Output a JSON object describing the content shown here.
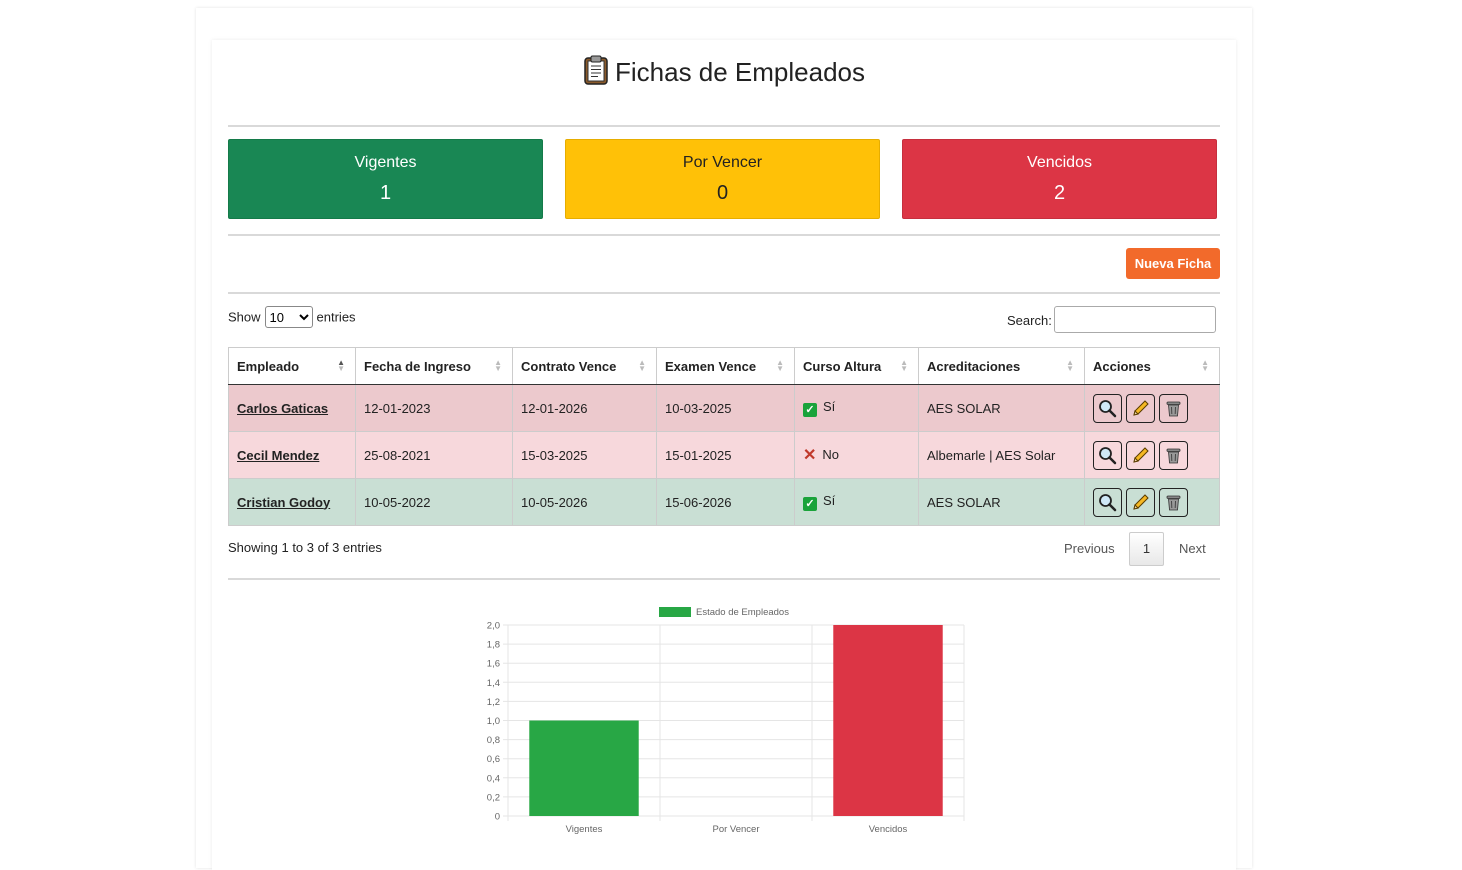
{
  "page": {
    "title": "Fichas de Empleados",
    "title_icon": "clipboard-icon"
  },
  "stats": [
    {
      "label": "Vigentes",
      "value": "1",
      "color": "#198754"
    },
    {
      "label": "Por Vencer",
      "value": "0",
      "color": "#ffc107"
    },
    {
      "label": "Vencidos",
      "value": "2",
      "color": "#dc3545"
    }
  ],
  "toolbar": {
    "new_label": "Nueva Ficha",
    "new_color": "#f26a2b"
  },
  "table_controls": {
    "show_label": "Show",
    "entries_label": "entries",
    "page_size": "10",
    "search_label": "Search:",
    "search_value": ""
  },
  "table": {
    "columns": [
      "Empleado",
      "Fecha de Ingreso",
      "Contrato Vence",
      "Examen Vence",
      "Curso Altura",
      "Acreditaciones",
      "Acciones"
    ],
    "rows": [
      {
        "empleado": "Carlos Gaticas",
        "ingreso": "12-01-2023",
        "contrato": "12-01-2026",
        "examen": "10-03-2025",
        "curso": "Sí",
        "curso_ok": true,
        "acreditaciones": "AES SOLAR"
      },
      {
        "empleado": "Cecil Mendez",
        "ingreso": "25-08-2021",
        "contrato": "15-03-2025",
        "examen": "15-01-2025",
        "curso": "No",
        "curso_ok": false,
        "acreditaciones": "Albemarle | AES Solar"
      },
      {
        "empleado": "Cristian Godoy",
        "ingreso": "10-05-2022",
        "contrato": "10-05-2026",
        "examen": "15-06-2026",
        "curso": "Sí",
        "curso_ok": true,
        "acreditaciones": "AES SOLAR"
      }
    ],
    "actions": [
      "search-icon",
      "pencil-icon",
      "trash-icon"
    ]
  },
  "footer": {
    "info": "Showing 1 to 3 of 3 entries",
    "previous": "Previous",
    "page": "1",
    "next": "Next"
  },
  "chart_data": {
    "type": "bar",
    "legend": "Estado de Empleados",
    "legend_placement": "top",
    "categories": [
      "Vigentes",
      "Por Vencer",
      "Vencidos"
    ],
    "values": [
      1,
      0,
      2
    ],
    "colors": [
      "#28a745",
      "#ffc107",
      "#dc3545"
    ],
    "ylim": [
      0,
      2.0
    ],
    "yticks": [
      "0",
      "0,2",
      "0,4",
      "0,6",
      "0,8",
      "1,0",
      "1,2",
      "1,4",
      "1,6",
      "1,8",
      "2,0"
    ],
    "grid": true
  }
}
